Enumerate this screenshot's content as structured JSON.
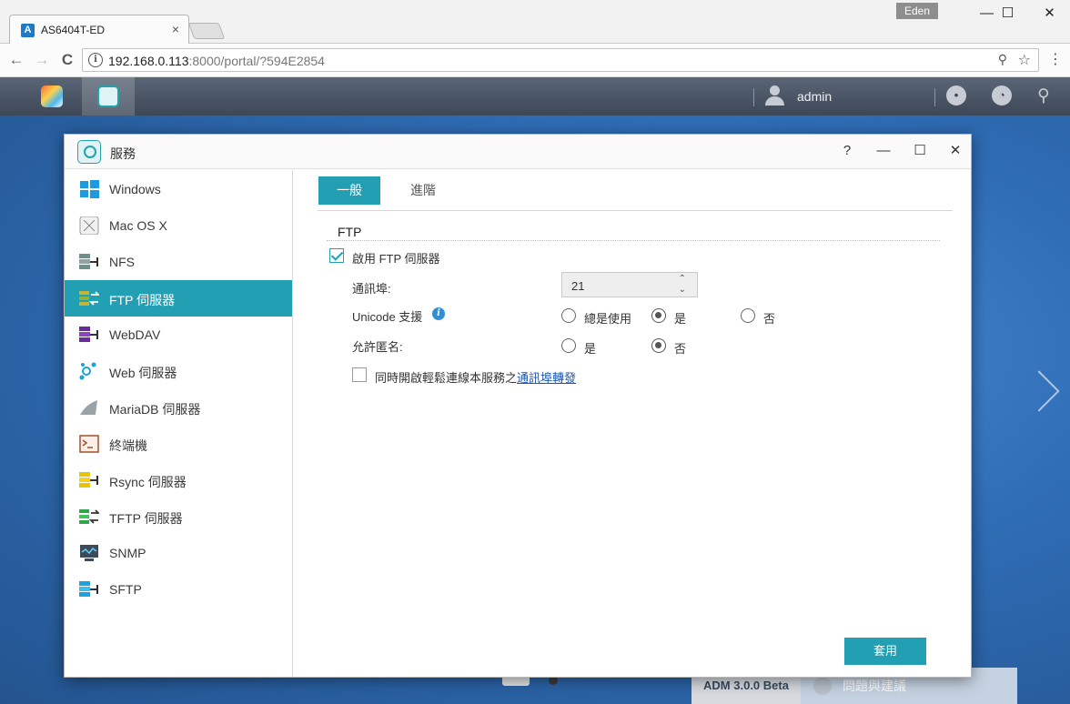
{
  "browser": {
    "tab_title": "AS6404T-ED",
    "tab_close": "×",
    "profile_name": "Eden",
    "url_host": "192.168.0.113",
    "url_rest": ":8000/portal/?594E2854",
    "back": "←",
    "forward": "→",
    "reload": "C",
    "minimize": "—",
    "maximize": "☐",
    "close": "✕",
    "key": "⚲",
    "star": "☆",
    "menu": "⋮",
    "info": "i"
  },
  "adm": {
    "username": "admin",
    "version": "ADM 3.0.0 Beta",
    "feedback": "問題與建議"
  },
  "window": {
    "title": "服務",
    "help": "?",
    "minimize": "—",
    "maximize": "☐",
    "close": "✕"
  },
  "sidebar": {
    "items": [
      {
        "label": "Windows",
        "icon": "windows-icon"
      },
      {
        "label": "Mac OS X",
        "icon": "macos-icon"
      },
      {
        "label": "NFS",
        "icon": "nfs-icon"
      },
      {
        "label": "FTP 伺服器",
        "icon": "ftp-icon"
      },
      {
        "label": "WebDAV",
        "icon": "webdav-icon"
      },
      {
        "label": "Web 伺服器",
        "icon": "web-server-icon"
      },
      {
        "label": "MariaDB 伺服器",
        "icon": "mariadb-icon"
      },
      {
        "label": "終端機",
        "icon": "terminal-icon"
      },
      {
        "label": "Rsync 伺服器",
        "icon": "rsync-icon"
      },
      {
        "label": "TFTP 伺服器",
        "icon": "tftp-icon"
      },
      {
        "label": "SNMP",
        "icon": "snmp-icon"
      },
      {
        "label": "SFTP",
        "icon": "sftp-icon"
      }
    ],
    "selected_index": 3
  },
  "tabs": {
    "general": "一般",
    "advanced": "進階"
  },
  "ftp": {
    "section_title": "FTP",
    "enable_label": "啟用 FTP 伺服器",
    "enable_checked": true,
    "port_label": "通訊埠:",
    "port_value": "21",
    "unicode_label": "Unicode 支援",
    "unicode_options": [
      "總是使用",
      "是",
      "否"
    ],
    "unicode_selected": "是",
    "anonymous_label": "允許匿名:",
    "anonymous_options": [
      "是",
      "否"
    ],
    "anonymous_selected": "否",
    "passthrough_text": "同時開啟輕鬆連線本服務之",
    "passthrough_link": "通訊埠轉發",
    "passthrough_checked": false,
    "apply_label": "套用"
  },
  "colors": {
    "accent": "#239fb3",
    "topbar": "#4a5566",
    "desktop": "#2f6db6"
  }
}
